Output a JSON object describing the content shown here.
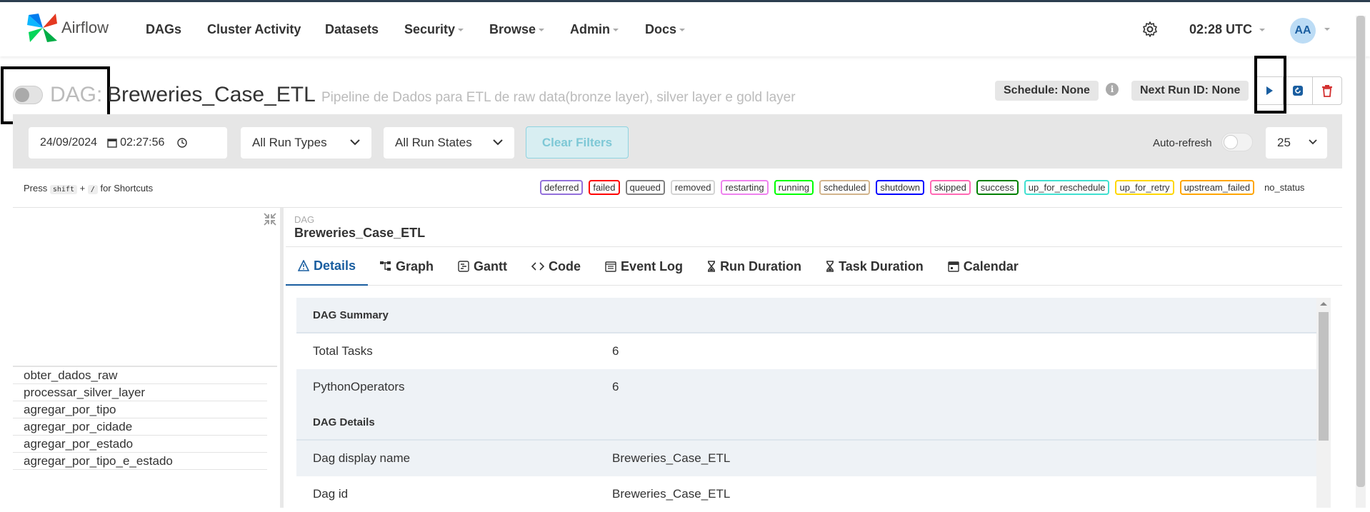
{
  "app": {
    "name": "Airflow"
  },
  "nav": {
    "items": [
      "DAGs",
      "Cluster Activity",
      "Datasets",
      "Security",
      "Browse",
      "Admin",
      "Docs"
    ],
    "time": "02:28 UTC",
    "avatar": "AA"
  },
  "dag": {
    "label": "DAG:",
    "name": "Breweries_Case_ETL",
    "description": "Pipeline de Dados para ETL de raw data(bronze layer), silver layer e gold layer",
    "schedule": "Schedule: None",
    "next_run": "Next Run ID: None",
    "paused": true
  },
  "filters": {
    "date": "24/09/2024",
    "time": "02:27:56",
    "run_types": "All Run Types",
    "run_states": "All Run States",
    "clear_label": "Clear Filters",
    "autorefresh_label": "Auto-refresh",
    "per_page": "25"
  },
  "shortcuts": {
    "prefix": "Press",
    "key1": "shift",
    "plus": "+",
    "key2": "/",
    "suffix": "for Shortcuts"
  },
  "legend": [
    {
      "label": "deferred",
      "color": "#9370db"
    },
    {
      "label": "failed",
      "color": "#ff0000"
    },
    {
      "label": "queued",
      "color": "#808080"
    },
    {
      "label": "removed",
      "color": "#d3d3d3"
    },
    {
      "label": "restarting",
      "color": "#ee82ee"
    },
    {
      "label": "running",
      "color": "#00ff00"
    },
    {
      "label": "scheduled",
      "color": "#d2b48c"
    },
    {
      "label": "shutdown",
      "color": "#0000ff"
    },
    {
      "label": "skipped",
      "color": "#ff69b4"
    },
    {
      "label": "success",
      "color": "#008000"
    },
    {
      "label": "up_for_reschedule",
      "color": "#40e0d0"
    },
    {
      "label": "up_for_retry",
      "color": "#ffd700"
    },
    {
      "label": "upstream_failed",
      "color": "#ffa500"
    },
    {
      "label": "no_status",
      "color": "transparent"
    }
  ],
  "tasks": [
    "obter_dados_raw",
    "processar_silver_layer",
    "agregar_por_tipo",
    "agregar_por_cidade",
    "agregar_por_estado",
    "agregar_por_tipo_e_estado"
  ],
  "details_header": {
    "small": "DAG",
    "name": "Breweries_Case_ETL"
  },
  "tabs": [
    "Details",
    "Graph",
    "Gantt",
    "Code",
    "Event Log",
    "Run Duration",
    "Task Duration",
    "Calendar"
  ],
  "summary": {
    "section1": "DAG Summary",
    "rows1": [
      {
        "key": "Total Tasks",
        "value": "6"
      },
      {
        "key": "PythonOperators",
        "value": "6"
      }
    ],
    "section2": "DAG Details",
    "rows2": [
      {
        "key": "Dag display name",
        "value": "Breweries_Case_ETL"
      },
      {
        "key": "Dag id",
        "value": "Breweries_Case_ETL"
      }
    ]
  }
}
